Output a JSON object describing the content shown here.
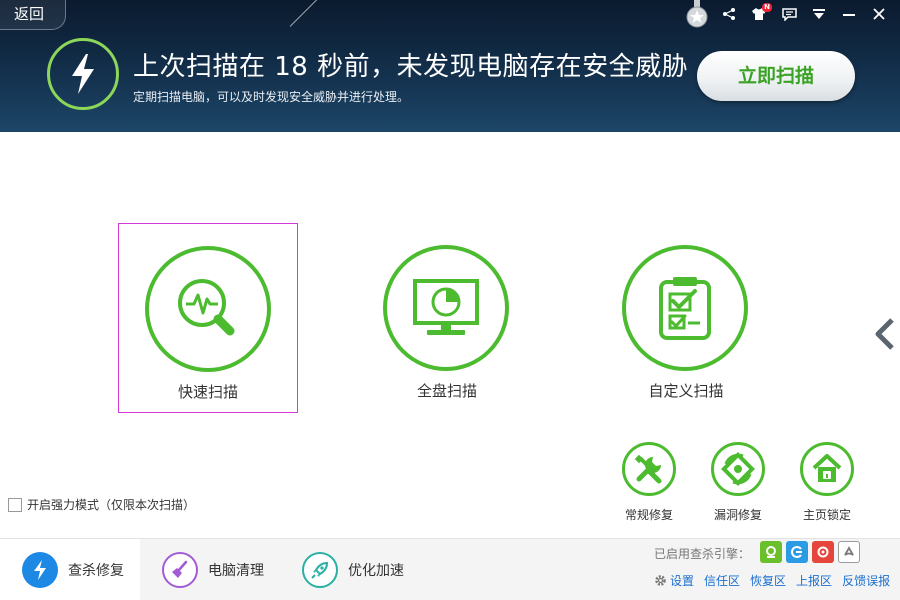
{
  "header": {
    "back_label": "返回",
    "headline": "上次扫描在 18 秒前，未发现电脑存在安全威胁",
    "subline": "定期扫描电脑，可以及时发现安全威胁并进行处理。",
    "scan_now_label": "立即扫描",
    "top_icons": [
      "medal-icon",
      "share-icon",
      "skin-icon",
      "message-icon",
      "menu-icon",
      "minimize-icon",
      "close-icon"
    ],
    "skin_badge": "N"
  },
  "scan_options": [
    {
      "label": "快速扫描",
      "icon": "quick-scan-icon",
      "selected": true
    },
    {
      "label": "全盘扫描",
      "icon": "full-scan-icon",
      "selected": false
    },
    {
      "label": "自定义扫描",
      "icon": "custom-scan-icon",
      "selected": false
    }
  ],
  "tools": [
    {
      "label": "常规修复",
      "icon": "tools-icon"
    },
    {
      "label": "漏洞修复",
      "icon": "vulnerability-icon"
    },
    {
      "label": "主页锁定",
      "icon": "home-lock-icon"
    }
  ],
  "strong_mode": {
    "label": "开启强力模式（仅限本次扫描）",
    "checked": false
  },
  "bottom_tabs": [
    {
      "label": "查杀修复",
      "icon": "bolt-icon",
      "active": true
    },
    {
      "label": "电脑清理",
      "icon": "broom-icon",
      "active": false
    },
    {
      "label": "优化加速",
      "icon": "rocket-icon",
      "active": false
    }
  ],
  "engines": {
    "label": "已启用查杀引擎：",
    "icons": [
      "engine-green-icon",
      "engine-blue-icon",
      "engine-red-icon",
      "engine-gray-icon"
    ]
  },
  "bottom_links": {
    "settings": "设置",
    "trust": "信任区",
    "restore": "恢复区",
    "upload": "上报区",
    "feedback": "反馈误报"
  },
  "colors": {
    "accent_green": "#4cbb2f",
    "header_bg": "#13304c",
    "link_blue": "#1a6fd0",
    "selection": "#d23bd6"
  }
}
